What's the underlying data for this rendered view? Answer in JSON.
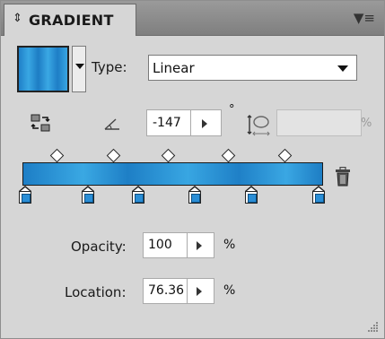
{
  "panel": {
    "title": "GRADIENT",
    "icons": {
      "collapse": "double-arrow-icon",
      "menu": "panel-menu-icon"
    }
  },
  "type": {
    "label": "Type:",
    "value": "Linear"
  },
  "angle": {
    "value": "-147",
    "unit": "°"
  },
  "aspect": {
    "value": "",
    "unit": "%"
  },
  "opacity": {
    "label": "Opacity:",
    "value": "100",
    "unit": "%"
  },
  "location": {
    "label": "Location:",
    "value": "76.36",
    "unit": "%"
  },
  "colors": {
    "gradient_dark": "#1d7ec6",
    "gradient_light": "#3aa8e3",
    "panel_bg": "#d6d6d6"
  }
}
